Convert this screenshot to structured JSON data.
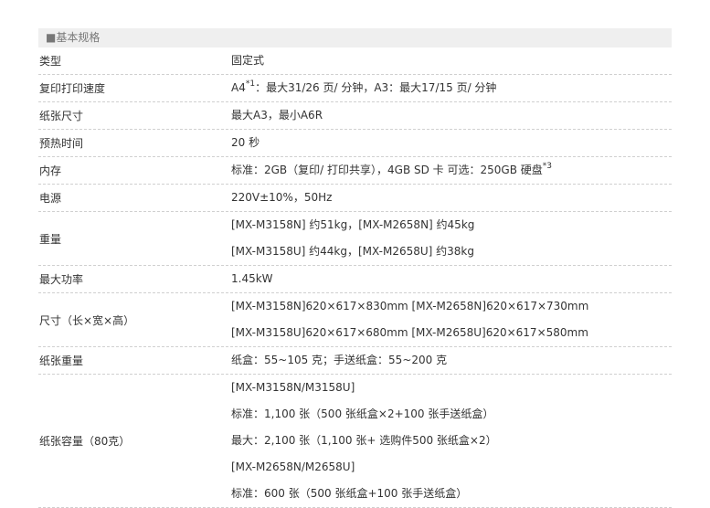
{
  "section": {
    "title": "■基本规格"
  },
  "rows": [
    {
      "label": "类型",
      "lines": [
        "固定式"
      ]
    },
    {
      "label": "复印打印速度",
      "prefix": "A4",
      "sup": "*1",
      "rest": "：最大31/26 页/ 分钟，A3：最大17/15 页/ 分钟"
    },
    {
      "label": "纸张尺寸",
      "lines": [
        "最大A3，最小A6R"
      ]
    },
    {
      "label": "预热时间",
      "lines": [
        "20 秒"
      ]
    },
    {
      "label": "内存",
      "prefix": "标准：2GB（复印/ 打印共享），4GB SD 卡 可选：250GB 硬盘",
      "sup": "*3",
      "rest": ""
    },
    {
      "label": "电源",
      "lines": [
        "220V±10%，50Hz"
      ]
    },
    {
      "label": "重量",
      "lines": [
        "[MX-M3158N] 约51kg，[MX-M2658N] 约45kg",
        "[MX-M3158U] 约44kg，[MX-M2658U] 约38kg"
      ]
    },
    {
      "label": "最大功率",
      "lines": [
        "1.45kW"
      ]
    },
    {
      "label": "尺寸（长×宽×高）",
      "lines": [
        "[MX-M3158N]620×617×830mm [MX-M2658N]620×617×730mm",
        "[MX-M3158U]620×617×680mm [MX-M2658U]620×617×580mm"
      ]
    },
    {
      "label": "纸张重量",
      "lines": [
        "纸盒：55~105 克；手送纸盒：55~200 克"
      ]
    },
    {
      "label": "纸张容量（80克）",
      "lines": [
        "[MX-M3158N/M3158U]",
        "标准：1,100 张（500 张纸盒×2+100 张手送纸盒）",
        "最大：2,100 张（1,100 张+ 选购件500 张纸盒×2）",
        "[MX-M2658N/M2658U]",
        "标准：600 张（500 张纸盒+100 张手送纸盒）"
      ]
    }
  ]
}
